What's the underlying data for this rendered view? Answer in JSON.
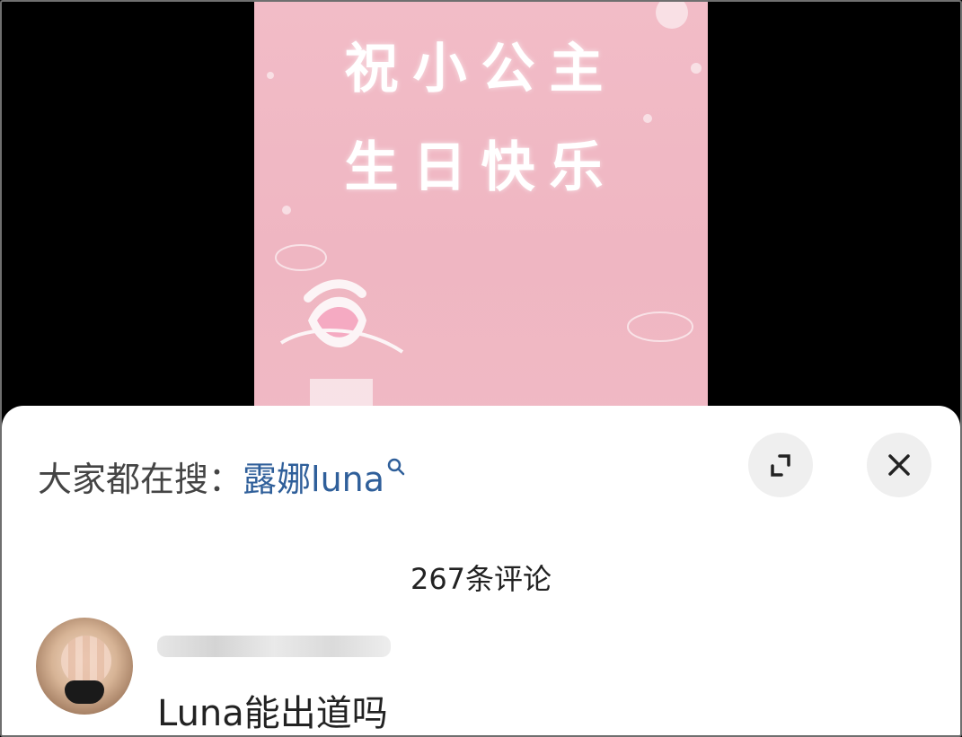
{
  "video": {
    "overlay_line1": "祝小公主",
    "overlay_line2": "生日快乐",
    "background_color": "#f0b9c4"
  },
  "sheet": {
    "trending_prefix": "大家都在搜：",
    "trending_term": "露娜luna",
    "trending_icon": "search-icon",
    "expand_icon": "expand-icon",
    "close_icon": "close-icon",
    "comment_count": "267条评论",
    "link_color": "#2f5f9a"
  },
  "comments": [
    {
      "text": "Luna能出道吗"
    }
  ]
}
